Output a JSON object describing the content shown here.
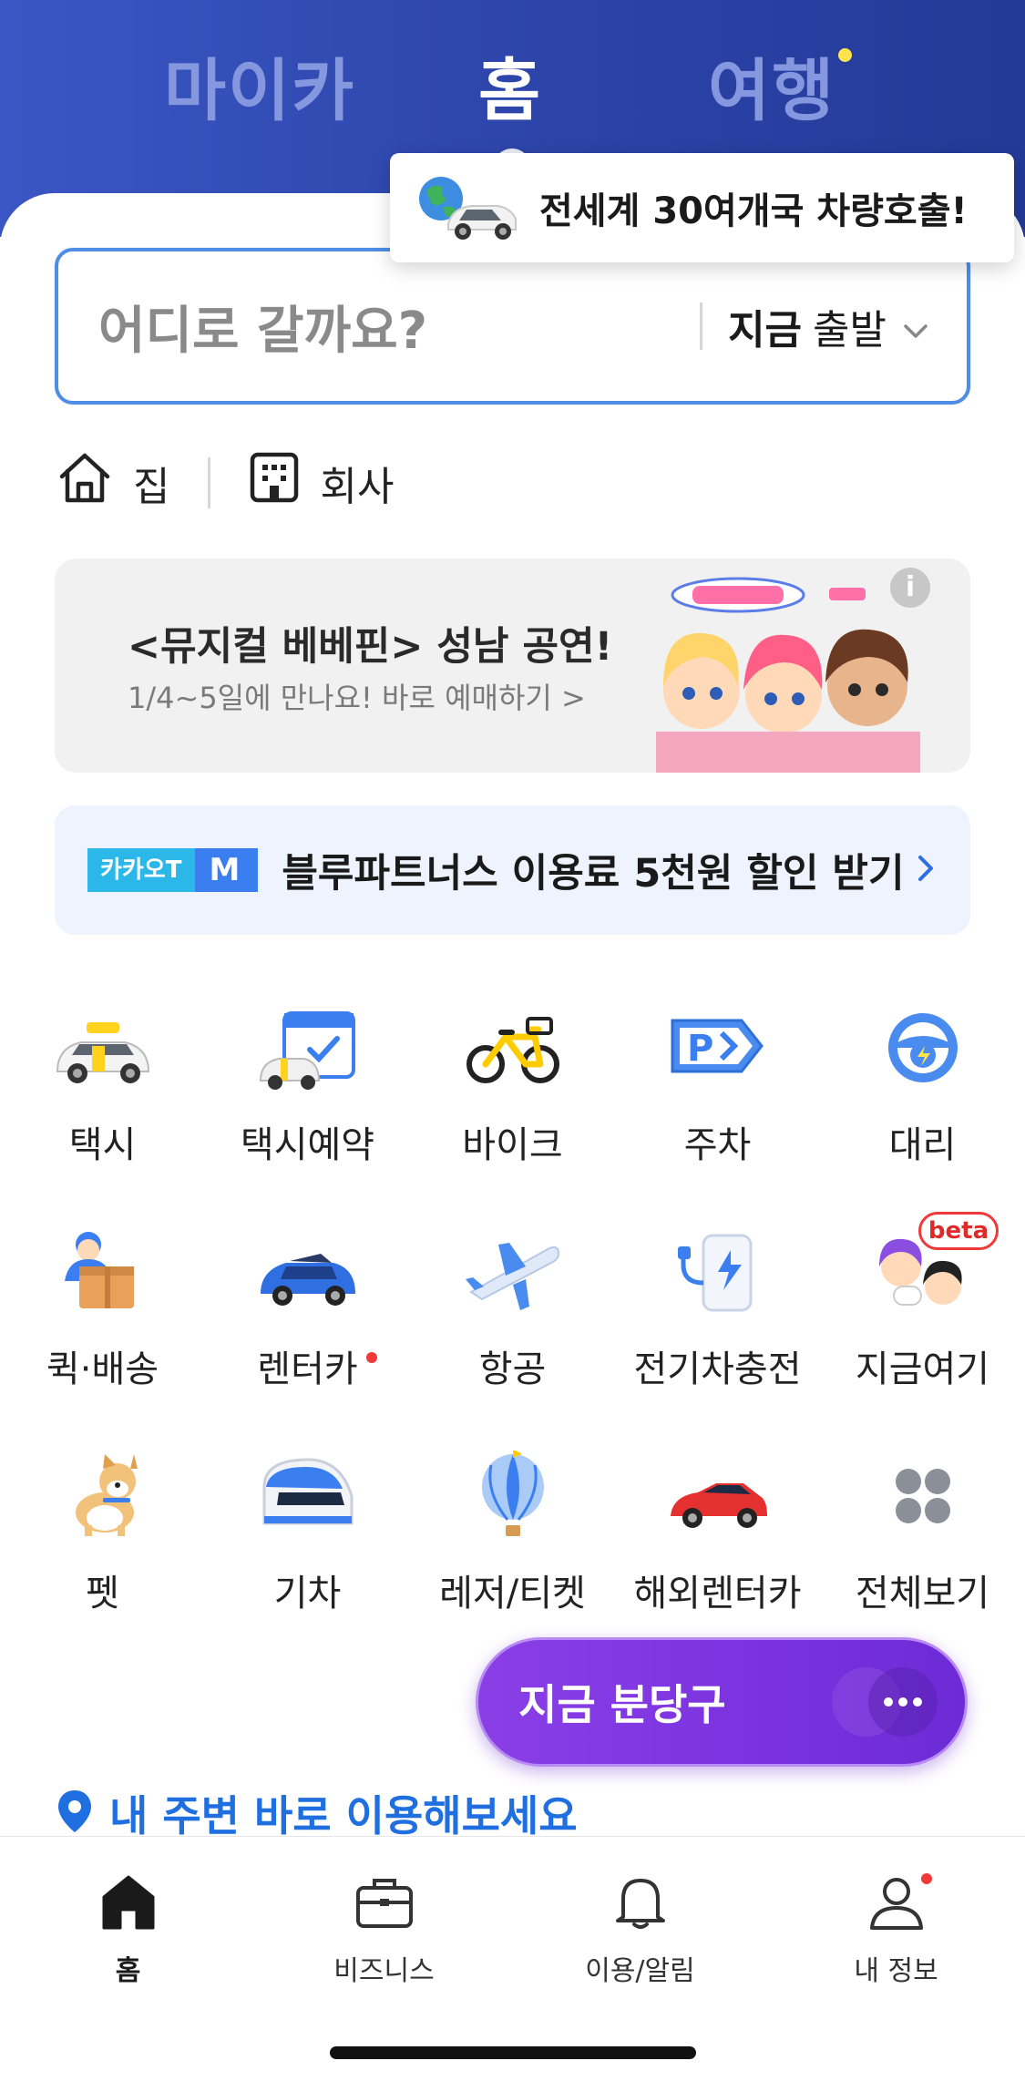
{
  "header": {
    "tabs": [
      {
        "label": "마이카",
        "active": false
      },
      {
        "label": "홈",
        "active": true
      },
      {
        "label": "여행",
        "active": false,
        "has_new_dot": true
      }
    ]
  },
  "tooltip": {
    "text": "전세계 30여개국 차량호출!",
    "icon": "globe-car-icon"
  },
  "search": {
    "placeholder": "어디로 갈까요?",
    "depart_bold": "지금",
    "depart_rest": "출발"
  },
  "quick_places": [
    {
      "label": "집",
      "icon": "home-icon"
    },
    {
      "label": "회사",
      "icon": "building-icon"
    }
  ],
  "banner": {
    "title": "<뮤지컬 베베핀> 성남 공연!",
    "subtitle": "1/4~5일에 만나요! 바로 예매하기 >",
    "info": "i"
  },
  "promo": {
    "logo_left": "카카오T",
    "logo_right": "M",
    "text": "블루파트너스 이용료 5천원 할인 받기"
  },
  "services": [
    {
      "label": "택시",
      "icon": "taxi-icon"
    },
    {
      "label": "택시예약",
      "icon": "taxi-reservation-icon"
    },
    {
      "label": "바이크",
      "icon": "bike-icon"
    },
    {
      "label": "주차",
      "icon": "parking-icon"
    },
    {
      "label": "대리",
      "icon": "steering-wheel-icon"
    },
    {
      "label": "퀵·배송",
      "icon": "delivery-icon"
    },
    {
      "label": "렌터카",
      "icon": "rental-car-icon",
      "dot": true
    },
    {
      "label": "항공",
      "icon": "airplane-icon"
    },
    {
      "label": "전기차충전",
      "icon": "ev-charger-icon"
    },
    {
      "label": "지금여기",
      "icon": "people-icon",
      "badge": "beta"
    },
    {
      "label": "펫",
      "icon": "dog-icon"
    },
    {
      "label": "기차",
      "icon": "train-icon"
    },
    {
      "label": "레저/티켓",
      "icon": "balloon-icon"
    },
    {
      "label": "해외렌터카",
      "icon": "sports-car-icon"
    },
    {
      "label": "전체보기",
      "icon": "grid-dots-icon"
    }
  ],
  "fab": {
    "label": "지금 분당구"
  },
  "nearby": {
    "title": "내 주변 바로 이용해보세요"
  },
  "bottom_nav": [
    {
      "label": "홈",
      "icon": "home-filled-icon",
      "active": true
    },
    {
      "label": "비즈니스",
      "icon": "briefcase-icon"
    },
    {
      "label": "이용/알림",
      "icon": "bell-icon"
    },
    {
      "label": "내 정보",
      "icon": "person-icon",
      "dot": true
    }
  ],
  "colors": {
    "header_blue": "#2c44a8",
    "accent_blue": "#1f6fe0",
    "purple": "#7a32df",
    "new_dot": "#ffe34c",
    "alert_dot": "#f03a3a"
  }
}
